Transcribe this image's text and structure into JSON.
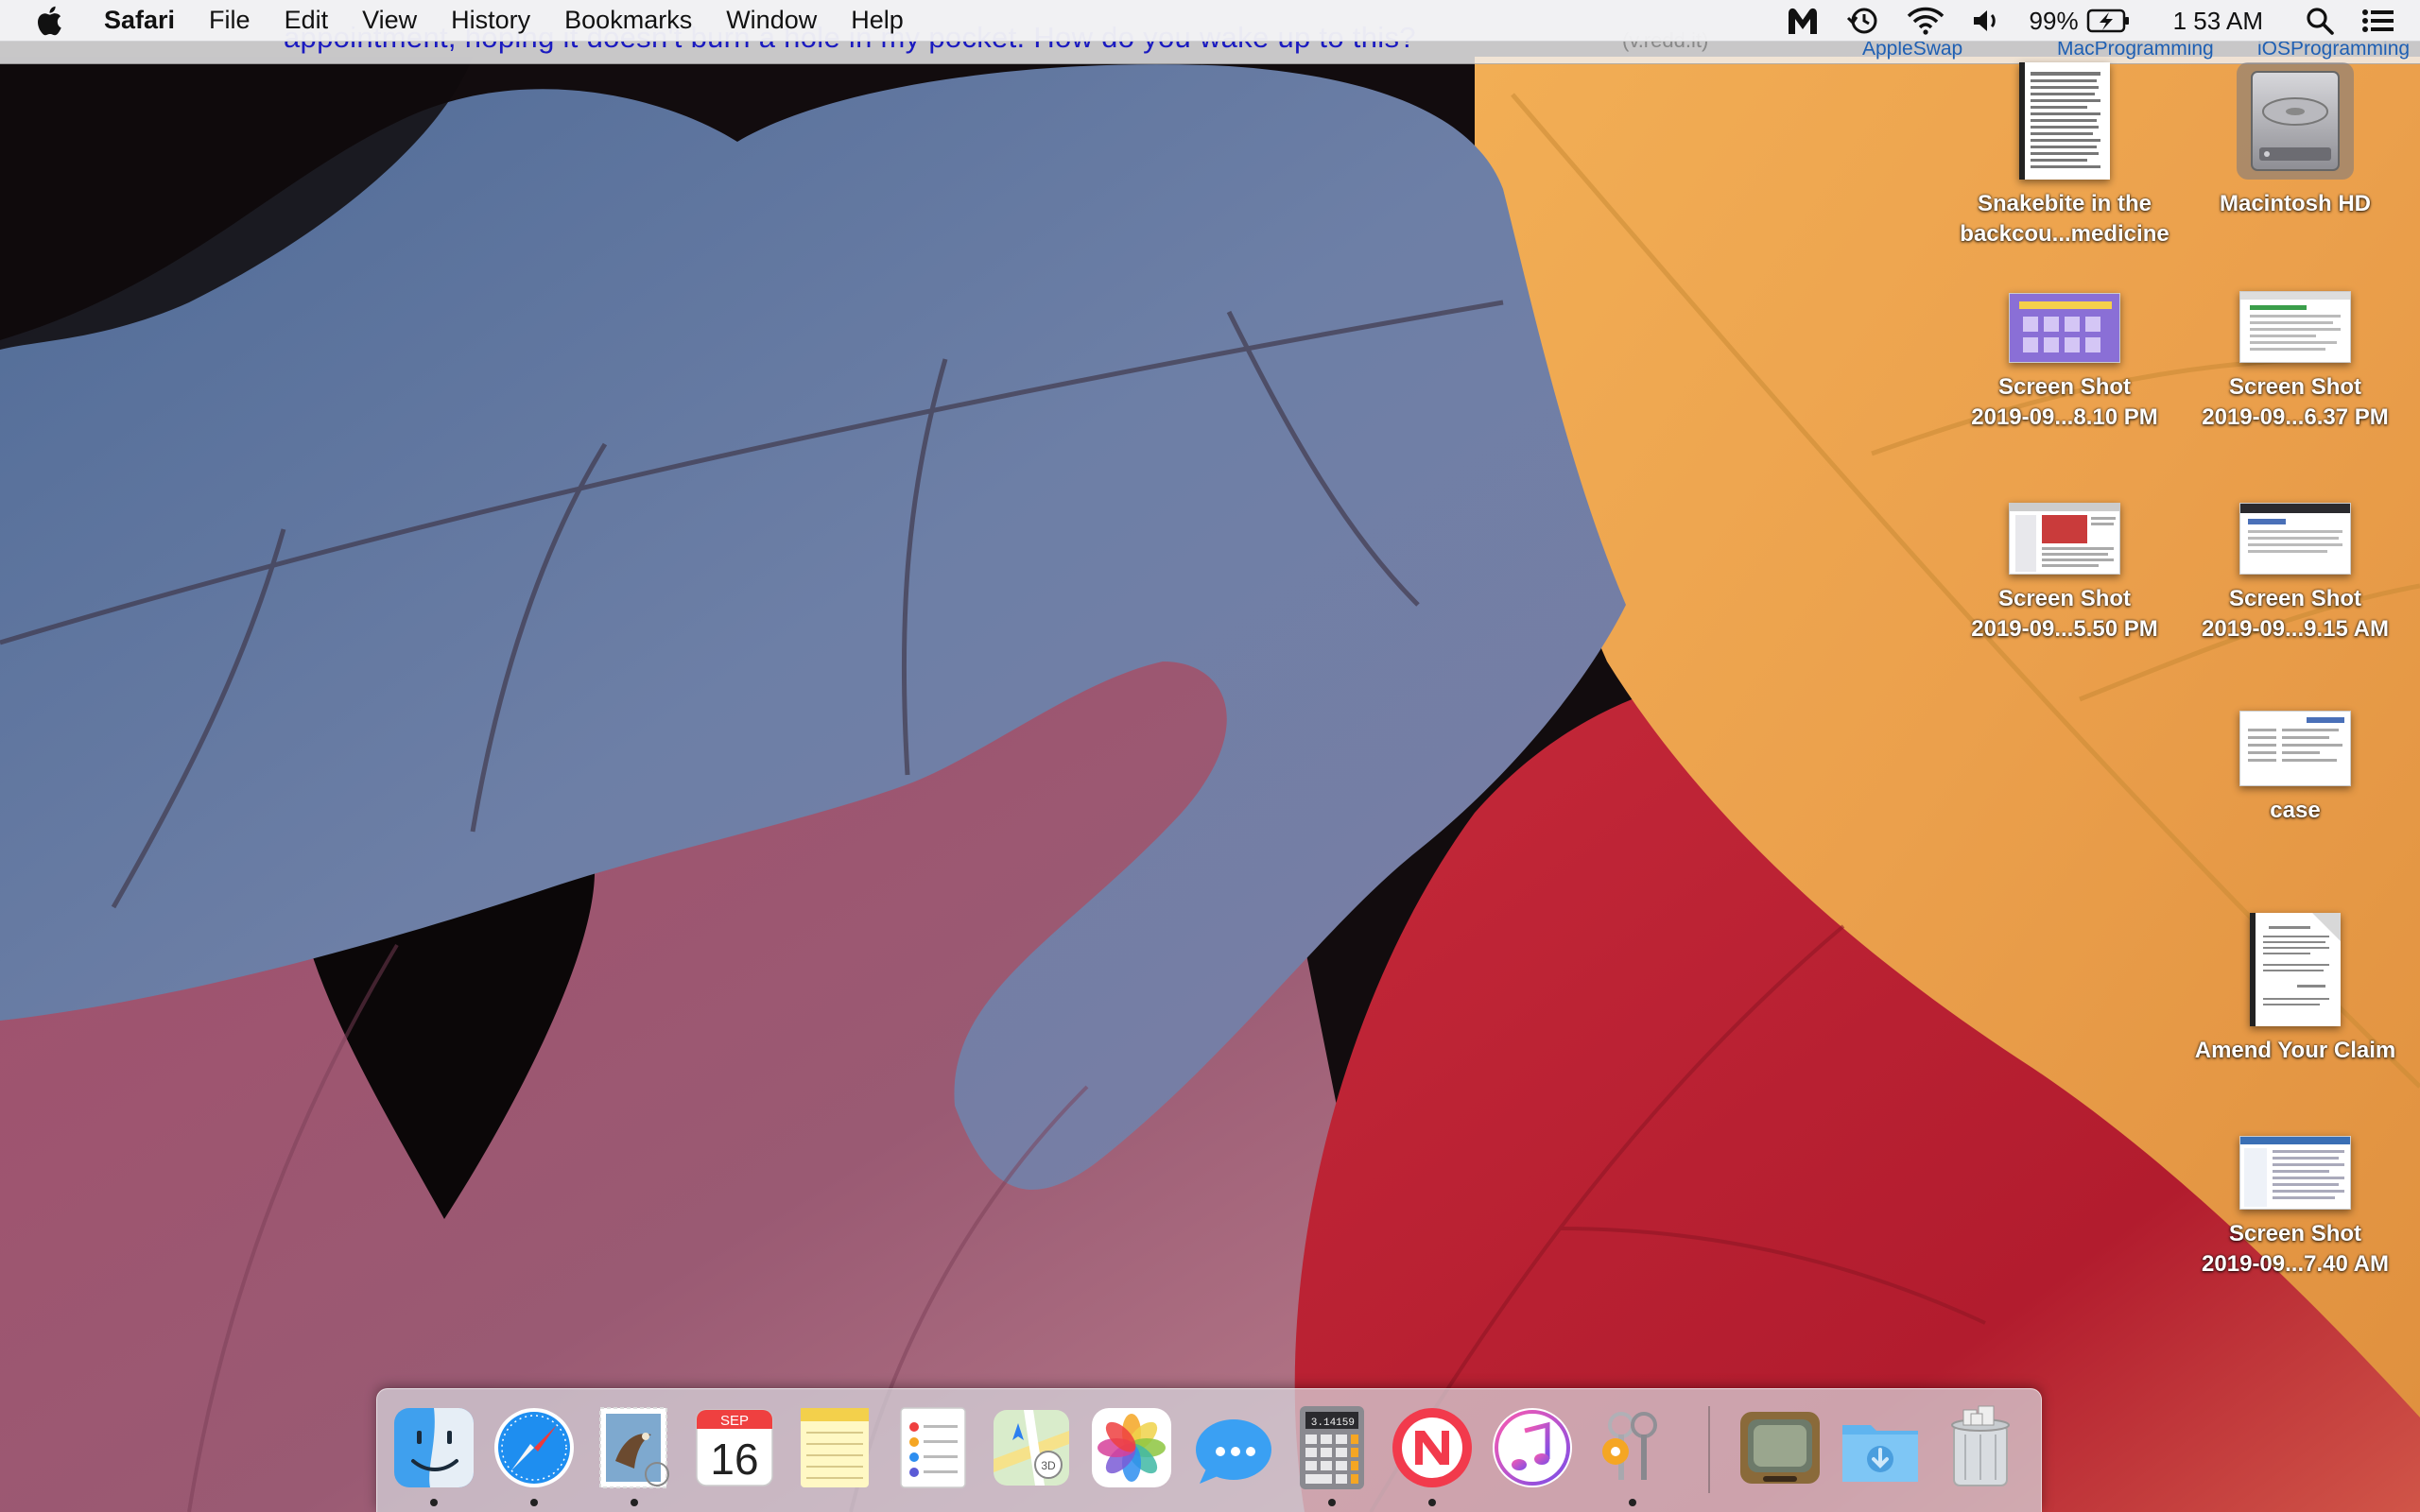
{
  "menubar": {
    "app_name": "Safari",
    "menus": [
      "File",
      "Edit",
      "View",
      "History",
      "Bookmarks",
      "Window",
      "Help"
    ],
    "battery_percent": "99%",
    "clock": "1 53 AM"
  },
  "background_window": {
    "headline": "appointment, hoping it doesn't burn a hole in my pocket. How do you wake up to this?",
    "domain": "(v.redd.it)",
    "links": [
      "AppleSwap",
      "MacProgramming",
      "iOSProgramming"
    ]
  },
  "desktop": {
    "icons": [
      {
        "line1": "Snakebite in the",
        "line2": "backcou...medicine"
      },
      {
        "line1": "Macintosh HD",
        "line2": ""
      },
      {
        "line1": "Screen Shot",
        "line2": "2019-09...8.10 PM"
      },
      {
        "line1": "Screen Shot",
        "line2": "2019-09...6.37 PM"
      },
      {
        "line1": "Screen Shot",
        "line2": "2019-09...5.50 PM"
      },
      {
        "line1": "Screen Shot",
        "line2": "2019-09...9.15 AM"
      },
      {
        "line1": "case",
        "line2": ""
      },
      {
        "line1": "Amend Your Claim",
        "line2": ""
      },
      {
        "line1": "Screen Shot",
        "line2": "2019-09...7.40 AM"
      }
    ]
  },
  "dock": {
    "calendar_month": "SEP",
    "calendar_day": "16",
    "calculator_display": "3.14159"
  },
  "colors": {
    "menubar_bg": "#f3f3f5",
    "link_blue": "#1e5fb3",
    "headline_blue": "#1a1ac0",
    "selection_gray": "#78787f"
  }
}
